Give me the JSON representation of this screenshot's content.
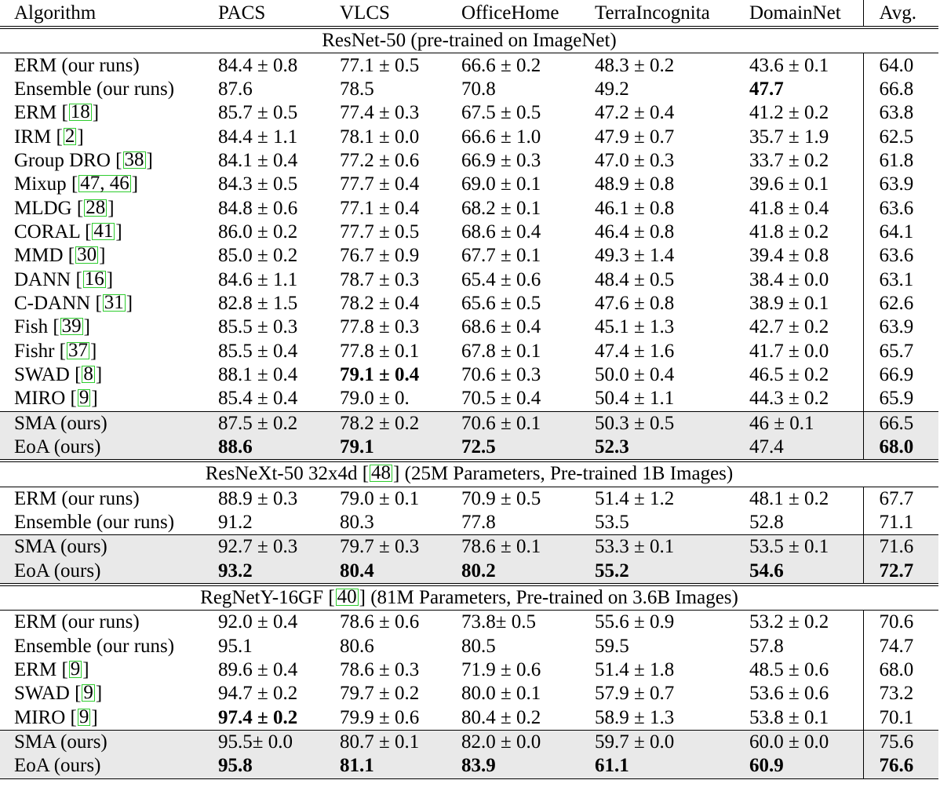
{
  "table": {
    "headers": [
      "Algorithm",
      "PACS",
      "VLCS",
      "OfficeHome",
      "TerraIncognita",
      "DomainNet",
      "Avg."
    ],
    "sections": [
      {
        "title": "ResNet-50 (pre-trained on ImageNet)",
        "rows": [
          {
            "algo": "ERM (our runs)",
            "ref": "",
            "vals": [
              "84.4 ± 0.8",
              "77.1 ± 0.5",
              "66.6 ± 0.2",
              "48.3 ± 0.2",
              "43.6 ± 0.1",
              "64.0"
            ],
            "bold": [],
            "gray": false
          },
          {
            "algo": "Ensemble (our runs)",
            "ref": "",
            "vals": [
              "87.6",
              "78.5",
              "70.8",
              "49.2",
              "47.7",
              "66.8"
            ],
            "bold": [
              4
            ],
            "gray": false
          },
          {
            "algo": "ERM",
            "ref": "18",
            "vals": [
              "85.7 ± 0.5",
              "77.4 ± 0.3",
              "67.5 ± 0.5",
              "47.2 ± 0.4",
              "41.2 ± 0.2",
              "63.8"
            ],
            "bold": [],
            "gray": false
          },
          {
            "algo": "IRM",
            "ref": "2",
            "vals": [
              "84.4 ± 1.1",
              "78.1 ± 0.0",
              "66.6 ± 1.0",
              "47.9 ± 0.7",
              "35.7 ± 1.9",
              "62.5"
            ],
            "bold": [],
            "gray": false
          },
          {
            "algo": "Group DRO",
            "ref": "38",
            "vals": [
              "84.1 ± 0.4",
              "77.2 ± 0.6",
              "66.9 ± 0.3",
              "47.0 ± 0.3",
              "33.7 ± 0.2",
              "61.8"
            ],
            "bold": [],
            "gray": false
          },
          {
            "algo": "Mixup",
            "ref": "47, 46",
            "vals": [
              "84.3 ± 0.5",
              "77.7 ± 0.4",
              "69.0 ± 0.1",
              "48.9 ± 0.8",
              "39.6 ± 0.1",
              "63.9"
            ],
            "bold": [],
            "gray": false
          },
          {
            "algo": "MLDG",
            "ref": "28",
            "vals": [
              "84.8 ± 0.6",
              "77.1 ± 0.4",
              "68.2 ± 0.1",
              "46.1 ± 0.8",
              "41.8 ± 0.4",
              "63.6"
            ],
            "bold": [],
            "gray": false
          },
          {
            "algo": "CORAL",
            "ref": "41",
            "vals": [
              "86.0 ± 0.2",
              "77.7 ± 0.5",
              "68.6 ± 0.4",
              "46.4 ± 0.8",
              "41.8 ± 0.2",
              "64.1"
            ],
            "bold": [],
            "gray": false
          },
          {
            "algo": "MMD",
            "ref": "30",
            "vals": [
              "85.0 ± 0.2",
              "76.7 ± 0.9",
              "67.7 ± 0.1",
              "49.3 ± 1.4",
              "39.4 ± 0.8",
              "63.6"
            ],
            "bold": [],
            "gray": false
          },
          {
            "algo": "DANN",
            "ref": "16",
            "vals": [
              "84.6 ± 1.1",
              "78.7 ± 0.3",
              "65.4 ± 0.6",
              "48.4 ± 0.5",
              "38.4 ± 0.0",
              "63.1"
            ],
            "bold": [],
            "gray": false
          },
          {
            "algo": "C-DANN",
            "ref": "31",
            "vals": [
              "82.8 ± 1.5",
              "78.2 ± 0.4",
              "65.6 ± 0.5",
              "47.6 ± 0.8",
              "38.9 ± 0.1",
              "62.6"
            ],
            "bold": [],
            "gray": false
          },
          {
            "algo": "Fish",
            "ref": "39",
            "vals": [
              "85.5 ± 0.3",
              "77.8 ± 0.3",
              "68.6 ± 0.4",
              "45.1 ± 1.3",
              "42.7 ± 0.2",
              "63.9"
            ],
            "bold": [],
            "gray": false
          },
          {
            "algo": "Fishr",
            "ref": "37",
            "vals": [
              "85.5 ± 0.4",
              "77.8 ± 0.1",
              "67.8 ± 0.1",
              "47.4 ± 1.6",
              "41.7 ± 0.0",
              "65.7"
            ],
            "bold": [],
            "gray": false
          },
          {
            "algo": "SWAD",
            "ref": "8",
            "vals": [
              "88.1 ± 0.4",
              "79.1 ± 0.4",
              "70.6 ± 0.3",
              "50.0 ± 0.4",
              "46.5 ± 0.2",
              "66.9"
            ],
            "bold": [
              1
            ],
            "gray": false
          },
          {
            "algo": "MIRO",
            "ref": "9",
            "vals": [
              "85.4 ± 0.4",
              "79.0 ± 0.",
              "70.5 ± 0.4",
              "50.4 ± 1.1",
              "44.3 ± 0.2",
              "65.9"
            ],
            "bold": [],
            "gray": false
          },
          {
            "algo": "SMA (ours)",
            "ref": "",
            "vals": [
              "87.5 ± 0.2",
              "78.2 ± 0.2",
              "70.6 ± 0.1",
              "50.3 ± 0.5",
              "46 ± 0.1",
              "66.5"
            ],
            "bold": [],
            "gray": true
          },
          {
            "algo": "EoA (ours)",
            "ref": "",
            "vals": [
              "88.6",
              "79.1",
              "72.5",
              "52.3",
              "47.4",
              "68.0"
            ],
            "bold": [
              0,
              1,
              2,
              3,
              5
            ],
            "gray": true
          }
        ]
      },
      {
        "title": "ResNeXt-50 32x4d [48] (25M Parameters, Pre-trained 1B Images)",
        "rows": [
          {
            "algo": "ERM (our runs)",
            "ref": "",
            "vals": [
              "88.9 ± 0.3",
              "79.0 ± 0.1",
              "70.9 ± 0.5",
              "51.4 ± 1.2",
              "48.1 ± 0.2",
              "67.7"
            ],
            "bold": [],
            "gray": false
          },
          {
            "algo": "Ensemble (our runs)",
            "ref": "",
            "vals": [
              "91.2",
              "80.3",
              "77.8",
              "53.5",
              "52.8",
              "71.1"
            ],
            "bold": [],
            "gray": false
          },
          {
            "algo": "SMA (ours)",
            "ref": "",
            "vals": [
              "92.7 ± 0.3",
              "79.7 ± 0.3",
              "78.6 ± 0.1",
              "53.3 ± 0.1",
              "53.5 ± 0.1",
              "71.6"
            ],
            "bold": [],
            "gray": true
          },
          {
            "algo": "EoA (ours)",
            "ref": "",
            "vals": [
              "93.2",
              "80.4",
              "80.2",
              "55.2",
              "54.6",
              "72.7"
            ],
            "bold": [
              0,
              1,
              2,
              3,
              4,
              5
            ],
            "gray": true
          }
        ]
      },
      {
        "title": "RegNetY-16GF [40] (81M Parameters, Pre-trained on 3.6B Images)",
        "rows": [
          {
            "algo": "ERM (our runs)",
            "ref": "",
            "vals": [
              "92.0 ± 0.4",
              "78.6 ± 0.6",
              "73.8± 0.5",
              "55.6 ± 0.9",
              "53.2 ± 0.2",
              "70.6"
            ],
            "bold": [],
            "gray": false
          },
          {
            "algo": "Ensemble (our runs)",
            "ref": "",
            "vals": [
              "95.1",
              "80.6",
              "80.5",
              "59.5",
              "57.8",
              "74.7"
            ],
            "bold": [],
            "gray": false
          },
          {
            "algo": "ERM",
            "ref": "9",
            "vals": [
              "89.6 ± 0.4",
              "78.6 ± 0.3",
              "71.9 ± 0.6",
              "51.4 ± 1.8",
              "48.5 ± 0.6",
              "68.0"
            ],
            "bold": [],
            "gray": false
          },
          {
            "algo": "SWAD",
            "ref": "9",
            "vals": [
              "94.7 ± 0.2",
              "79.7 ± 0.2",
              "80.0 ± 0.1",
              "57.9 ± 0.7",
              "53.6 ± 0.6",
              "73.2"
            ],
            "bold": [],
            "gray": false
          },
          {
            "algo": "MIRO",
            "ref": "9",
            "vals": [
              "97.4 ± 0.2",
              "79.9 ± 0.6",
              "80.4 ± 0.2",
              "58.9 ± 1.3",
              "53.8 ± 0.1",
              "70.1"
            ],
            "bold": [
              0
            ],
            "gray": false
          },
          {
            "algo": "SMA (ours)",
            "ref": "",
            "vals": [
              "95.5± 0.0",
              "80.7 ± 0.1",
              "82.0 ± 0.0",
              "59.7 ± 0.0",
              "60.0 ± 0.0",
              "75.6"
            ],
            "bold": [],
            "gray": true
          },
          {
            "algo": "EoA (ours)",
            "ref": "",
            "vals": [
              "95.8",
              "81.1",
              "83.9",
              "61.1",
              "60.9",
              "76.6"
            ],
            "bold": [
              0,
              1,
              2,
              3,
              4,
              5
            ],
            "gray": true
          }
        ]
      }
    ]
  }
}
